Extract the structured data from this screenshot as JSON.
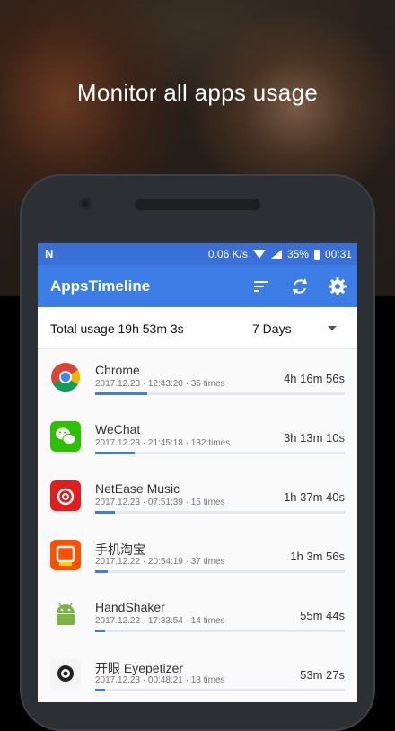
{
  "headline": "Monitor all apps usage",
  "status_bar": {
    "left_icon": "N",
    "speed": "0.06 K/s",
    "battery": "35%",
    "time": "00:31"
  },
  "toolbar": {
    "title": "AppsTimeline",
    "icons": [
      "sort-icon",
      "refresh-icon",
      "settings-icon"
    ]
  },
  "summary": {
    "total": "Total usage 19h 53m 3s",
    "period": "7 Days"
  },
  "apps": [
    {
      "name": "Chrome",
      "meta": "2017.12.23 · 12:43:20 · 35 times",
      "duration": "4h 16m 56s",
      "usage_fraction": 0.21,
      "icon": "chrome-icon",
      "color": "#db4437"
    },
    {
      "name": "WeChat",
      "meta": "2017.12.23 · 21:45:18 · 132 times",
      "duration": "3h 13m 10s",
      "usage_fraction": 0.16,
      "icon": "wechat-icon",
      "color": "#2dc100"
    },
    {
      "name": "NetEase Music",
      "meta": "2017.12.23 · 07:51:39 · 15 times",
      "duration": "1h 37m 40s",
      "usage_fraction": 0.08,
      "icon": "netease-music-icon",
      "color": "#e01e1e"
    },
    {
      "name": "手机淘宝",
      "meta": "2017.12.22 · 20:54:19 · 37 times",
      "duration": "1h 3m 56s",
      "usage_fraction": 0.05,
      "icon": "taobao-icon",
      "color": "#ff5000"
    },
    {
      "name": "HandShaker",
      "meta": "2017.12.22 · 17:33:54 · 14 times",
      "duration": "55m 44s",
      "usage_fraction": 0.04,
      "icon": "android-icon",
      "color": "#7cb342"
    },
    {
      "name": "开眼 Eyepetizer",
      "meta": "2017.12.23 · 00:48:21 · 18 times",
      "duration": "53m 27s",
      "usage_fraction": 0.04,
      "icon": "eye-icon",
      "color": "#222222"
    }
  ]
}
